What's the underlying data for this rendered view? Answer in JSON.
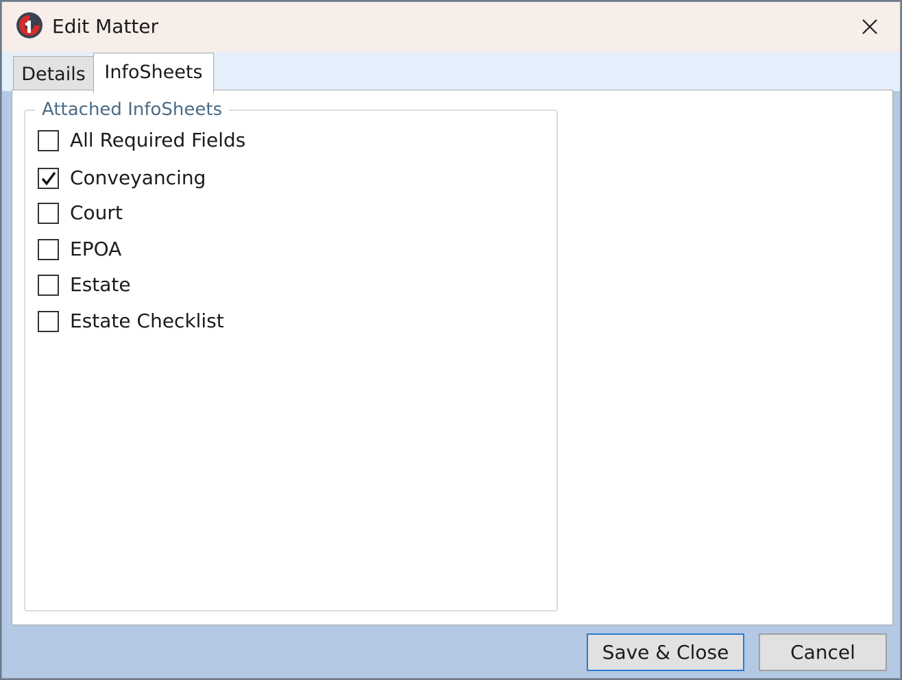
{
  "window": {
    "title": "Edit Matter",
    "app_icon": "app-logo-icon",
    "close_icon": "close-icon"
  },
  "tabs": [
    {
      "label": "Details",
      "selected": false
    },
    {
      "label": "InfoSheets",
      "selected": true
    }
  ],
  "infosheets": {
    "group_label": "Attached InfoSheets",
    "items": [
      {
        "label": "All Required Fields",
        "checked": false
      },
      {
        "label": "Conveyancing",
        "checked": true
      },
      {
        "label": "Court",
        "checked": false
      },
      {
        "label": "EPOA",
        "checked": false
      },
      {
        "label": "Estate",
        "checked": false
      },
      {
        "label": "Estate Checklist",
        "checked": false
      }
    ]
  },
  "buttons": {
    "save_label": "Save & Close",
    "cancel_label": "Cancel"
  },
  "colors": {
    "titlebar": "#f7eeea",
    "tabstrip": "#e5effb",
    "footer": "#b3c9e4",
    "accent": "#2a7bd6",
    "logo_red": "#d42b2b",
    "logo_dark": "#3a4250"
  }
}
